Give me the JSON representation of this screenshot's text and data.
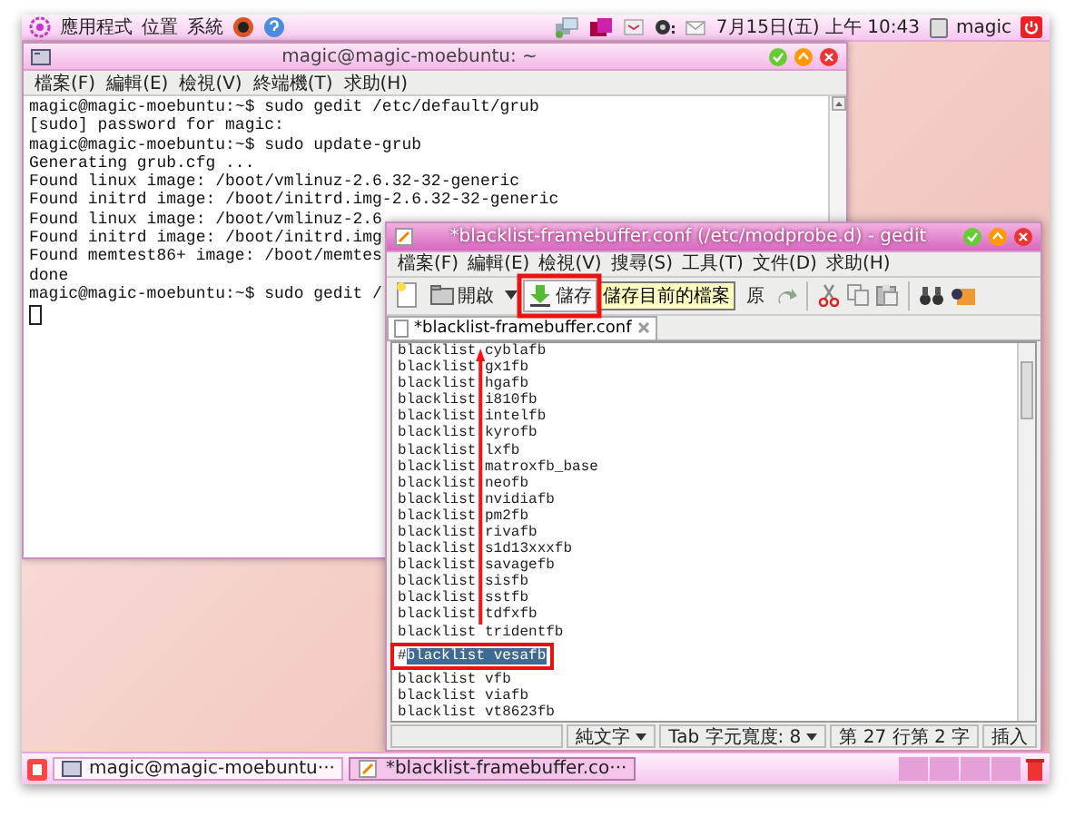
{
  "top_panel": {
    "menus": [
      "應用程式",
      "位置",
      "系統"
    ],
    "clock": "7月15日(五) 上午 10:43",
    "user": "magic"
  },
  "terminal": {
    "title": "magic@magic-moebuntu: ~",
    "menu": [
      "檔案(F)",
      "編輯(E)",
      "檢視(V)",
      "終端機(T)",
      "求助(H)"
    ],
    "lines": [
      "magic@magic-moebuntu:~$ sudo gedit /etc/default/grub",
      "[sudo] password for magic:",
      "magic@magic-moebuntu:~$ sudo update-grub",
      "Generating grub.cfg ...",
      "Found linux image: /boot/vmlinuz-2.6.32-32-generic",
      "Found initrd image: /boot/initrd.img-2.6.32-32-generic",
      "Found linux image: /boot/vmlinuz-2.6",
      "Found initrd image: /boot/initrd.img",
      "Found memtest86+ image: /boot/memtes",
      "done",
      "magic@magic-moebuntu:~$ sudo gedit /"
    ]
  },
  "gedit": {
    "title": "*blacklist-framebuffer.conf (/etc/modprobe.d) - gedit",
    "menu": [
      "檔案(F)",
      "編輯(E)",
      "檢視(V)",
      "搜尋(S)",
      "工具(T)",
      "文件(D)",
      "求助(H)"
    ],
    "toolbar": {
      "open": "開啟",
      "save": "儲存",
      "undo": "原",
      "tooltip": "儲存目前的檔案"
    },
    "tab": "*blacklist-framebuffer.conf",
    "lines": [
      {
        "text": "blacklist cyblafb",
        "selected": false
      },
      {
        "text": "blacklist gx1fb",
        "selected": false
      },
      {
        "text": "blacklist hgafb",
        "selected": false
      },
      {
        "text": "blacklist i810fb",
        "selected": false
      },
      {
        "text": "blacklist intelfb",
        "selected": false
      },
      {
        "text": "blacklist kyrofb",
        "selected": false
      },
      {
        "text": "blacklist lxfb",
        "selected": false
      },
      {
        "text": "blacklist matroxfb_base",
        "selected": false
      },
      {
        "text": "blacklist neofb",
        "selected": false
      },
      {
        "text": "blacklist nvidiafb",
        "selected": false
      },
      {
        "text": "blacklist pm2fb",
        "selected": false
      },
      {
        "text": "blacklist rivafb",
        "selected": false
      },
      {
        "text": "blacklist s1d13xxxfb",
        "selected": false
      },
      {
        "text": "blacklist savagefb",
        "selected": false
      },
      {
        "text": "blacklist sisfb",
        "selected": false
      },
      {
        "text": "blacklist sstfb",
        "selected": false
      },
      {
        "text": "blacklist tdfxfb",
        "selected": false
      },
      {
        "text": "blacklist tridentfb",
        "selected": false
      },
      {
        "prefix": "#",
        "text": "blacklist vesafb",
        "selected": true
      },
      {
        "text": "blacklist vfb",
        "selected": false
      },
      {
        "text": "blacklist viafb",
        "selected": false
      },
      {
        "text": "blacklist vt8623fb",
        "selected": false
      }
    ],
    "status": [
      {
        "text": "純文字",
        "kind": "dropdown"
      },
      {
        "text": "Tab 字元寬度: 8",
        "kind": "dropdown"
      },
      {
        "text": "第 27 行第 2 字",
        "kind": "plain"
      },
      {
        "text": "插入",
        "kind": "plain"
      }
    ]
  },
  "taskbar": [
    {
      "label": "magic@magic-moebuntu···",
      "selected": false
    },
    {
      "label": "*blacklist-framebuffer.co···",
      "selected": true
    }
  ]
}
